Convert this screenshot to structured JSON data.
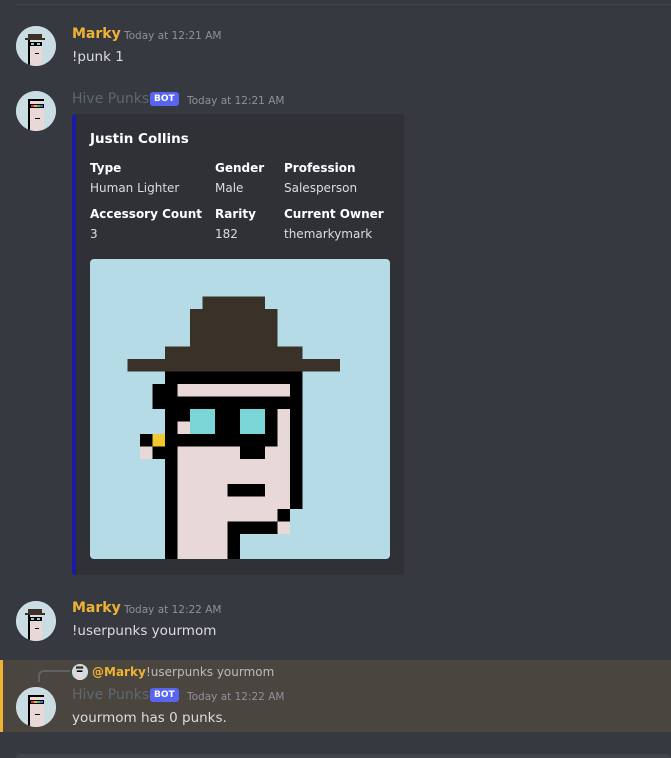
{
  "messages": [
    {
      "username": "Marky",
      "timestamp": "Today at 12:21 AM",
      "content": "!punk 1"
    },
    {
      "username": "Hive Punks",
      "badge": "BOT",
      "timestamp": "Today at 12:21 AM"
    },
    {
      "username": "Marky",
      "timestamp": "Today at 12:22 AM",
      "content": "!userpunks yourmom"
    },
    {
      "username": "Hive Punks",
      "badge": "BOT",
      "timestamp": "Today at 12:22 AM",
      "content": "yourmom has 0 punks."
    }
  ],
  "embed": {
    "accent_color": "#1a1aa8",
    "title": "Justin Collins",
    "fields": [
      {
        "name": "Type",
        "value": "Human Lighter"
      },
      {
        "name": "Gender",
        "value": "Male"
      },
      {
        "name": "Profession",
        "value": "Salesperson"
      },
      {
        "name": "Accessory Count",
        "value": "3"
      },
      {
        "name": "Rarity",
        "value": "182"
      },
      {
        "name": "Current Owner",
        "value": "themarkymark"
      }
    ]
  },
  "reply": {
    "mention": "@Marky",
    "text": "!userpunks yourmom"
  },
  "colors": {
    "background": "#36393f",
    "username_marky": "#f0b232",
    "bot_badge": "#5865f2",
    "highlight": "#4b4540"
  },
  "icons": {
    "avatar_marky": "pixel-punk-hat-avatar",
    "avatar_bot": "pixel-punk-visor-avatar"
  }
}
